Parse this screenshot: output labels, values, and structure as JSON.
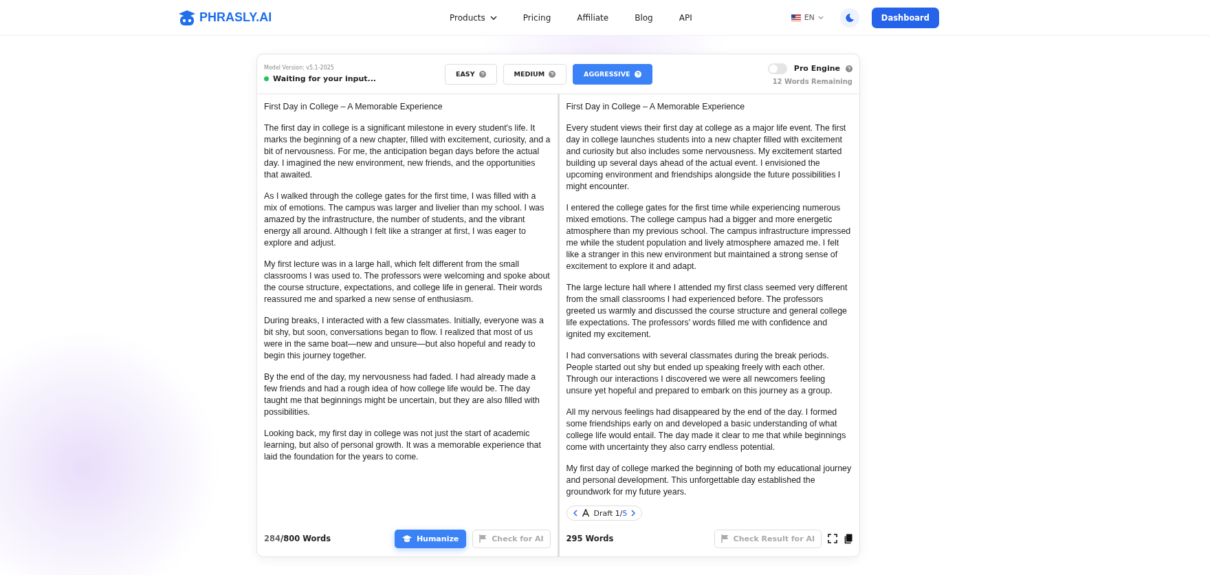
{
  "header": {
    "logo": "PHRASLY.AI",
    "nav": [
      {
        "label": "Products",
        "dropdown": true
      },
      {
        "label": "Pricing",
        "dropdown": false
      },
      {
        "label": "Affiliate",
        "dropdown": false
      },
      {
        "label": "Blog",
        "dropdown": false
      },
      {
        "label": "API",
        "dropdown": false
      }
    ],
    "language": "EN",
    "dashboard": "Dashboard"
  },
  "toolbar": {
    "model_version": "Model Version: v5.1-2025",
    "status": {
      "text": "Waiting for your input...",
      "color": "#22c55e"
    },
    "modes": [
      {
        "label": "EASY",
        "selected": false
      },
      {
        "label": "MEDIUM",
        "selected": false
      },
      {
        "label": "AGGRESSIVE",
        "selected": true
      }
    ],
    "pro_engine": {
      "label": "Pro Engine",
      "on": false
    },
    "remaining": "12 Words Remaining"
  },
  "input": {
    "paragraphs": [
      "First Day in College – A Memorable Experience",
      "The first day in college is a significant milestone in every student's life. It marks the beginning of a new chapter, filled with excitement, curiosity, and a bit of nervousness. For me, the anticipation began days before the actual day. I imagined the new environment, new friends, and the opportunities that awaited.",
      "As I walked through the college gates for the first time, I was filled with a mix of emotions. The campus was larger and livelier than my school. I was amazed by the infrastructure, the number of students, and the vibrant energy all around. Although I felt like a stranger at first, I was eager to explore and adjust.",
      "My first lecture was in a large hall, which felt different from the small classrooms I was used to. The professors were welcoming and spoke about the course structure, expectations, and college life in general. Their words reassured me and sparked a new sense of enthusiasm.",
      "During breaks, I interacted with a few classmates. Initially, everyone was a bit shy, but soon, conversations began to flow. I realized that most of us were in the same boat—new and unsure—but also hopeful and ready to begin this journey together.",
      "By the end of the day, my nervousness had faded. I had already made a few friends and had a rough idea of how college life would be. The day taught me that beginnings might be uncertain, but they are also filled with possibilities.",
      "Looking back, my first day in college was not just the start of academic learning, but also of personal growth. It was a memorable experience that laid the foundation for the years to come."
    ],
    "count": "284",
    "limit": "/800 Words",
    "humanize": "Humanize",
    "check": "Check for AI"
  },
  "output": {
    "paragraphs": [
      "First Day in College – A Memorable Experience",
      "Every student views their first day at college as a major life event. The first day in college launches students into a new chapter filled with excitement and curiosity but also includes some nervousness. My excitement started building up several days ahead of the actual event. I envisioned the upcoming environment and friendships alongside the future possibilities I might encounter.",
      "I entered the college gates for the first time while experiencing numerous mixed emotions. The college campus had a bigger and more energetic atmosphere than my previous school. The campus infrastructure impressed me while the student population and lively atmosphere amazed me. I felt like a stranger in this new environment but maintained a strong sense of excitement to explore it and adapt.",
      "The large lecture hall where I attended my first class seemed very different from the small classrooms I had experienced before. The professors greeted us warmly and discussed the course structure and general college life expectations. The professors' words filled me with confidence and ignited my excitement.",
      "I had conversations with several classmates during the break periods. People started out shy but ended up speaking freely with each other. Through our interactions I discovered we were all newcomers feeling unsure yet hopeful and prepared to embark on this journey as a group.",
      "All my nervous feelings had disappeared by the end of the day. I formed some friendships early on and developed a basic understanding of what college life would entail. The day made it clear to me that while beginnings come with uncertainty they also carry endless potential.",
      "My first day of college marked the beginning of both my educational journey and personal development. This unforgettable day established the groundwork for my future years."
    ],
    "draft": "Draft 1/",
    "draft_total": "5",
    "count": "295 Words",
    "check": "Check Result for AI"
  }
}
